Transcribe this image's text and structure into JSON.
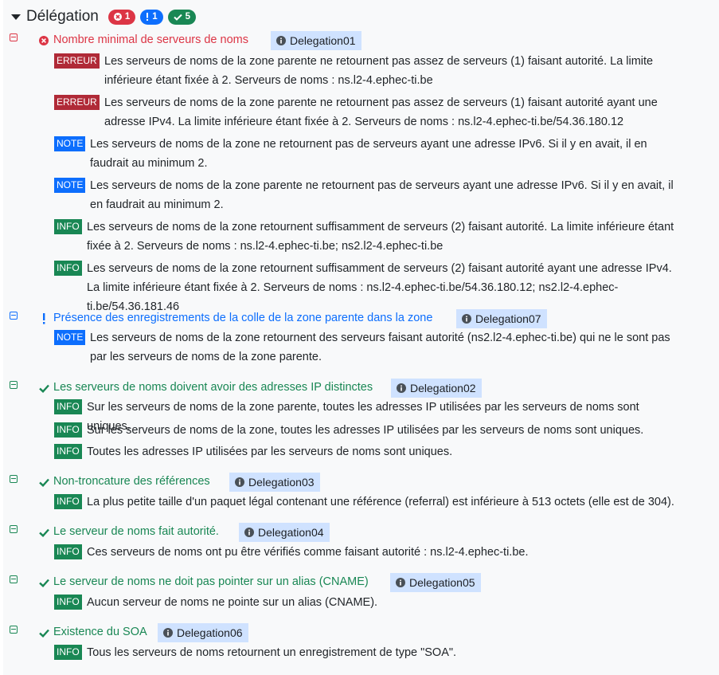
{
  "header": {
    "title": "Délégation",
    "counts": {
      "error": "1",
      "warning": "1",
      "success": "5"
    }
  },
  "tests": [
    {
      "name": "Nombre minimal de serveurs de noms",
      "id": "Delegation01",
      "status": "error",
      "messages": [
        {
          "level": "ERREUR",
          "text": "Les serveurs de noms de la zone parente ne retournent pas assez de serveurs (1) faisant autorité. La limite inférieure étant fixée à 2. Serveurs de noms : ns.l2-4.ephec-ti.be"
        },
        {
          "level": "ERREUR",
          "text": "Les serveurs de noms de la zone parente ne retournent pas assez de serveurs (1) faisant autorité ayant une adresse IPv4. La limite inférieure étant fixée à 2. Serveurs de noms : ns.l2-4.ephec-ti.be/54.36.180.12"
        },
        {
          "level": "NOTE",
          "text": "Les serveurs de noms de la zone ne retournent pas de serveurs ayant une adresse IPv6. Si il y en avait, il en faudrait au minimum 2."
        },
        {
          "level": "NOTE",
          "text": "Les serveurs de noms de la zone parente ne retournent pas de serveurs ayant une adresse IPv6. Si il y en avait, il en faudrait au minimum 2."
        },
        {
          "level": "INFO",
          "text": "Les serveurs de noms de la zone retournent suffisamment de serveurs (2) faisant autorité. La limite inférieure étant fixée à 2. Serveurs de noms : ns.l2-4.ephec-ti.be; ns2.l2-4.ephec-ti.be"
        },
        {
          "level": "INFO",
          "text": "Les serveurs de noms de la zone retournent suffisamment de serveurs (2) faisant autorité ayant une adresse IPv4. La limite inférieure étant fixée à 2. Serveurs de noms : ns.l2-4.ephec-ti.be/54.36.180.12; ns2.l2-4.ephec-ti.be/54.36.181.46"
        }
      ]
    },
    {
      "name": "Présence des enregistrements de la colle de la zone parente dans la zone",
      "id": "Delegation07",
      "status": "warning",
      "messages": [
        {
          "level": "NOTE",
          "text": "Les serveurs de noms de la zone retournent des serveurs faisant autorité (ns2.l2-4.ephec-ti.be) qui ne le sont pas par les serveurs de noms de la zone parente."
        }
      ]
    },
    {
      "name": "Les serveurs de noms doivent avoir des adresses IP distinctes",
      "id": "Delegation02",
      "status": "success",
      "messages": [
        {
          "level": "INFO",
          "text": "Sur les serveurs de noms de la zone parente, toutes les adresses IP utilisées par les serveurs de noms sont uniques."
        },
        {
          "level": "INFO",
          "text": "Sur les serveurs de noms de la zone, toutes les adresses IP utilisées par les serveurs de noms sont uniques."
        },
        {
          "level": "INFO",
          "text": "Toutes les adresses IP utilisées par les serveurs de noms sont uniques."
        }
      ]
    },
    {
      "name": "Non-troncature des références",
      "id": "Delegation03",
      "status": "success",
      "messages": [
        {
          "level": "INFO",
          "text": "La plus petite taille d'un paquet légal contenant une référence (referral) est inférieure à 513 octets (elle est de 304)."
        }
      ]
    },
    {
      "name": "Le serveur de noms fait autorité.",
      "id": "Delegation04",
      "status": "success",
      "messages": [
        {
          "level": "INFO",
          "text": "Ces serveurs de noms ont pu être vérifiés comme faisant autorité : ns.l2-4.ephec-ti.be."
        }
      ]
    },
    {
      "name": "Le serveur de noms ne doit pas pointer sur un alias (CNAME)",
      "id": "Delegation05",
      "status": "success",
      "messages": [
        {
          "level": "INFO",
          "text": "Aucun serveur de noms ne pointe sur un alias (CNAME)."
        }
      ]
    },
    {
      "name": "Existence du SOA",
      "id": "Delegation06",
      "status": "success",
      "messages": [
        {
          "level": "INFO",
          "text": "Tous les serveurs de noms retournent un enregistrement de type \"SOA\"."
        }
      ]
    }
  ]
}
